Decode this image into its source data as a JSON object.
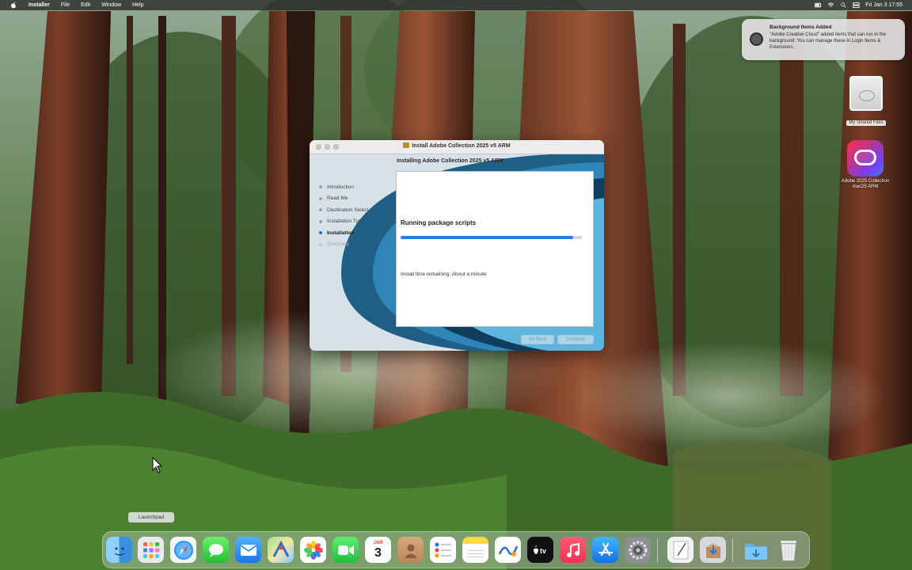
{
  "menubar": {
    "app_name": "Installer",
    "items": [
      "File",
      "Edit",
      "Window",
      "Help"
    ],
    "clock": "Fri Jan 3  17:55"
  },
  "notification": {
    "title": "Background Items Added",
    "body": "\"Adobe Creative Cloud\" added items that can run in the background. You can manage these in Login Items & Extensions."
  },
  "desktop_icons": {
    "disk_label": "My Shared Files",
    "cc_label": "Adobe 2025 Collection mac25 ARM"
  },
  "installer": {
    "window_title": "Install Adobe Collection 2025 v5 ARM",
    "subheader": "Installing Adobe Collection 2025 v5 ARM",
    "steps": [
      "Introduction",
      "Read Me",
      "Destination Select",
      "Installation Type",
      "Installation",
      "Summary"
    ],
    "current_step": "Installation",
    "status_text": "Running package scripts",
    "progress_percent": 95,
    "time_remaining": "Install time remaining: About a minute",
    "go_back_label": "Go Back",
    "continue_label": "Continue"
  },
  "tooltip": "Launchpad",
  "dock": {
    "calendar_month": "JAN",
    "calendar_day": "3",
    "apps": [
      "finder-icon",
      "launchpad-icon",
      "safari-icon",
      "messages-icon",
      "mail-icon",
      "maps-icon",
      "photos-icon",
      "facetime-icon",
      "calendar-icon",
      "contacts-icon",
      "reminders-icon",
      "notes-icon",
      "freeform-icon",
      "tv-icon",
      "music-icon",
      "app-store-icon",
      "system-settings-icon",
      "text-edit-icon",
      "installer-icon",
      "downloads-folder-icon",
      "trash-icon"
    ]
  },
  "colors": {
    "accent": "#2a7ed8",
    "window_bg": "#d9e4ea"
  }
}
